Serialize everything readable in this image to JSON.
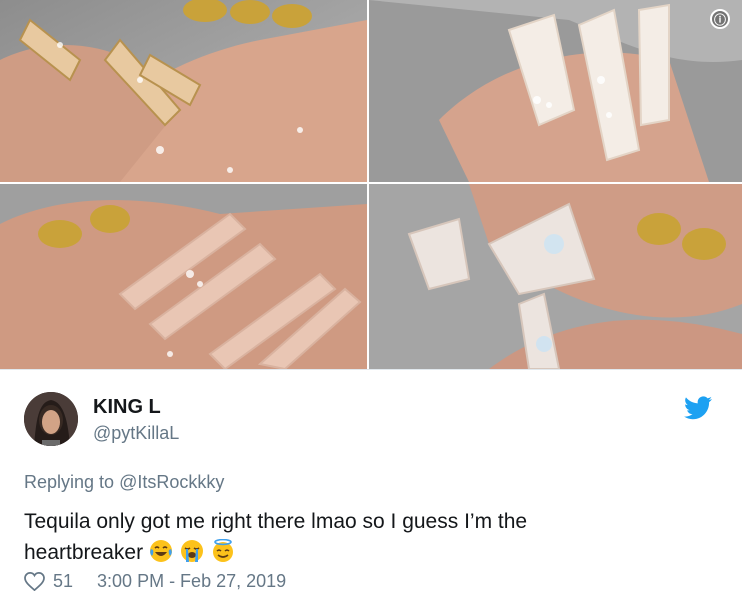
{
  "photos": [
    {
      "alt_icon": "nails-photo"
    },
    {
      "alt_icon": "nails-photo"
    },
    {
      "alt_icon": "nails-photo"
    },
    {
      "alt_icon": "nails-photo"
    }
  ],
  "info_icon": "ⓘ",
  "tweet": {
    "display_name": "KING L",
    "handle": "@pytKillaL",
    "replying_prefix": "Replying to",
    "replying_to": "@ItsRockkky",
    "text_line1": "Tequila only got me right there lmao so I guess I’m the",
    "text_line2": "heartbreaker",
    "emojis": [
      "face-with-tears-of-joy",
      "loudly-crying-face",
      "smiling-face-with-halo"
    ],
    "likes": "51",
    "timestamp": "3:00 PM - Feb 27, 2019"
  },
  "colors": {
    "twitter_blue": "#1da1f2",
    "secondary_text": "#657786",
    "primary_text": "#14171a"
  }
}
